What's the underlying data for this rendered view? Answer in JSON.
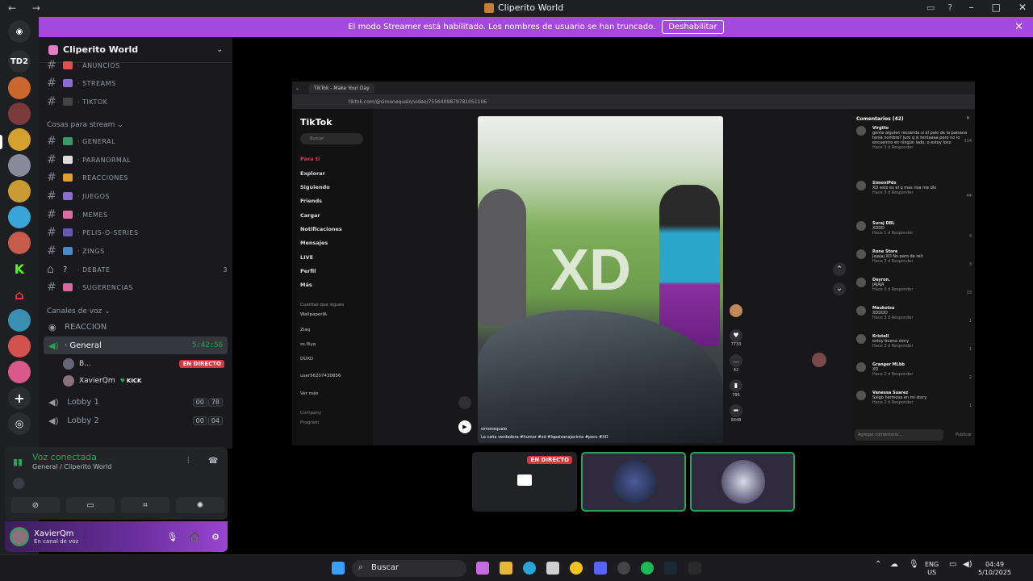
{
  "window": {
    "title": "Cliperito World"
  },
  "banner": {
    "text": "El modo Streamer está habilitado. Los nombres de usuario se han truncado.",
    "button": "Deshabilitar"
  },
  "servers": [
    {
      "label": "TD2",
      "color": "#2b2d31"
    }
  ],
  "guild": {
    "name": "Cliperito World"
  },
  "channels_top": [
    {
      "name": "ANUNCIOS"
    },
    {
      "name": "STREAMS"
    },
    {
      "name": "TIKTOK"
    }
  ],
  "category_stream": "Cosas para stream",
  "channels_stream": [
    {
      "name": "GENERAL",
      "count": ""
    },
    {
      "name": "PARANORMAL",
      "count": ""
    },
    {
      "name": "REACCIONES",
      "count": ""
    },
    {
      "name": "JUEGOS",
      "count": ""
    },
    {
      "name": "MEMES",
      "count": ""
    },
    {
      "name": "PELIS-O-SERIES",
      "count": ""
    },
    {
      "name": "ZINGS",
      "count": ""
    },
    {
      "name": "DEBATE",
      "count": "3"
    },
    {
      "name": "SUGERENCIAS",
      "count": ""
    }
  ],
  "category_voice": "Canales de voz",
  "voice": {
    "reaccion": "REACCION",
    "general": "General",
    "general_timer": "5:42:56",
    "users": [
      {
        "name": "B...",
        "live": "EN DIRECTO"
      },
      {
        "name": "XavierQm",
        "tag": "KICK"
      }
    ],
    "lobby1": {
      "name": "Lobby 1",
      "a": "00",
      "b": "78"
    },
    "lobby2": {
      "name": "Lobby 2",
      "a": "00",
      "b": "04"
    }
  },
  "voice_panel": {
    "title": "Voz conectada",
    "subtitle": "General / Cliperito World"
  },
  "user_panel": {
    "name": "XavierQm",
    "status": "En canal de voz"
  },
  "browser": {
    "tab": "TikTok - Make Your Day",
    "url": "tiktok.com/@simonequalo/video/7556409879781051106"
  },
  "tiktok": {
    "logo": "TikTok",
    "search": "Buscar",
    "nav": [
      "Para ti",
      "Explorar",
      "Siguiendo",
      "Friends",
      "Cargar",
      "Notificaciones",
      "Mensajes",
      "LIVE",
      "Perfil",
      "Más"
    ],
    "follow_title": "Cuentas que sigues",
    "follows": [
      "WallpaperIA",
      "Ziaq",
      "ss.fliya",
      "DUXO",
      "user56207430856"
    ],
    "more": "Ver más",
    "company": "Company",
    "program": "Program",
    "overlay_text": "XD",
    "video_user": "simonequalo",
    "video_caption": "La caña verdadera  #humor #xd #lapaisanajacinta #peru #XD",
    "likes": "7733",
    "comments_count": "42",
    "saves": "795",
    "shares": "5648"
  },
  "comments": {
    "header": "Comentarios (42)",
    "items": [
      {
        "user": "Virgilio",
        "text": "gente alguien recuerda si el palo de la paisana tenía nombre? juro q si tentaaaa pero no lo encuentro en ningún lado, o estoy loco",
        "meta": "Hace 3 d   Responder",
        "likes": "114"
      },
      {
        "user": "SimoniPdx",
        "text": "XD esto es el q mas risa me dio",
        "meta": "Hace 3 d   Responder",
        "likes": "44"
      },
      {
        "user": "Suraj DBL",
        "text": "XDDD",
        "meta": "Hace 1 d   Responder",
        "likes": "4"
      },
      {
        "user": "Rone Store",
        "text": "Jajajaj XD No paro de reír",
        "meta": "Hace 3 d   Responder",
        "likes": "3"
      },
      {
        "user": "Dayron.",
        "text": "JAJAJA",
        "meta": "Hace 3 d   Responder",
        "likes": "13"
      },
      {
        "user": "Maukotsu",
        "text": "XDDDD",
        "meta": "Hace 3 d   Responder",
        "likes": "1"
      },
      {
        "user": "Kristell",
        "text": "estoy buena story",
        "meta": "Hace 3 d   Responder",
        "likes": "1"
      },
      {
        "user": "Granger MLbb",
        "text": "XD",
        "meta": "Hace 2 d   Responder",
        "likes": "2"
      },
      {
        "user": "Vanessa Suarez",
        "text": "Salgo hermosa en mi story",
        "meta": "Hace 2 d   Responder",
        "likes": "1"
      }
    ],
    "input_placeholder": "Agregar comentario...",
    "post": "Publicar"
  },
  "tiles": {
    "live_label": "EN DIRECTO"
  },
  "taskbar": {
    "search": "Buscar",
    "lang": "ENG",
    "region": "US",
    "time": "04:49",
    "date": "5/10/2025"
  }
}
